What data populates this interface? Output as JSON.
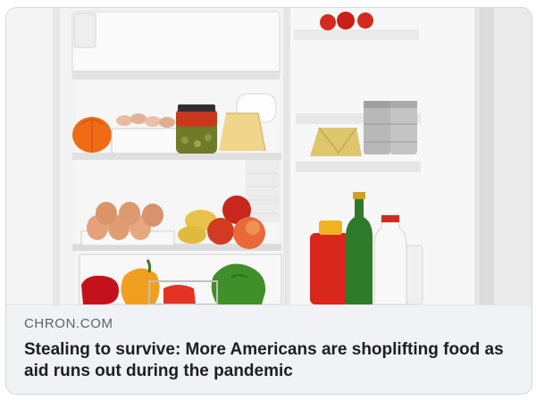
{
  "link_preview": {
    "image_subject": "open refrigerator with food",
    "source": "CHRON.COM",
    "headline": "Stealing to survive: More Americans are shoplifting food as aid runs out during the pandemic"
  },
  "colors": {
    "caption_background": "#f0f2f5",
    "source_text": "#5e6266",
    "headline_text": "#1c1e21",
    "card_border": "#d4d6da"
  }
}
